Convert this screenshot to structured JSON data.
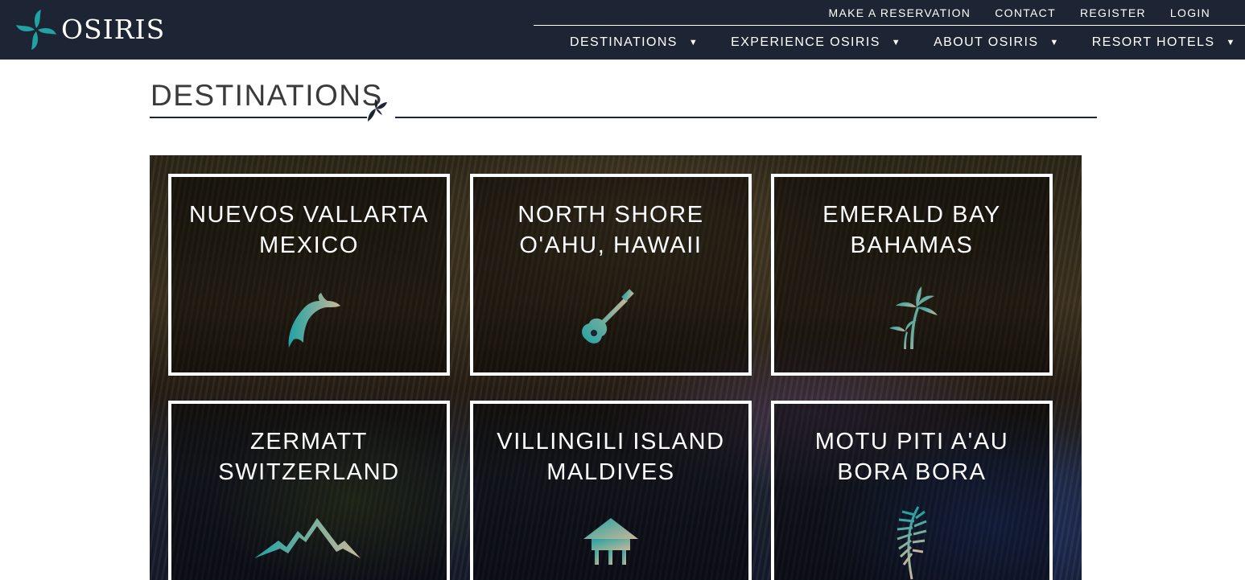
{
  "brand": {
    "name": "OSIRIS"
  },
  "utility_nav": [
    "MAKE A RESERVATION",
    "CONTACT",
    "REGISTER",
    "LOGIN"
  ],
  "main_nav": [
    {
      "label": "DESTINATIONS",
      "caret": "▼"
    },
    {
      "label": "EXPERIENCE OSIRIS",
      "caret": "▼"
    },
    {
      "label": "ABOUT OSIRIS",
      "caret": "▼"
    },
    {
      "label": "RESORT HOTELS",
      "caret": "▼"
    }
  ],
  "section": {
    "title": "DESTINATIONS",
    "icon": "leaf-icon"
  },
  "destinations": [
    {
      "line1": "NUEVOS VALLARTA",
      "line2": "MEXICO",
      "icon": "dolphin-icon"
    },
    {
      "line1": "NORTH SHORE",
      "line2": "O'AHU, HAWAII",
      "icon": "ukulele-icon"
    },
    {
      "line1": "EMERALD BAY",
      "line2": "BAHAMAS",
      "icon": "palm-tree-icon"
    },
    {
      "line1": "ZERMATT",
      "line2": "SWITZERLAND",
      "icon": "mountain-icon"
    },
    {
      "line1": "VILLINGILI ISLAND",
      "line2": "MALDIVES",
      "icon": "hut-icon"
    },
    {
      "line1": "MOTU PITI A'AU",
      "line2": "BORA BORA",
      "icon": "palm-frond-icon"
    }
  ],
  "colors": {
    "header_bg": "#1d2433",
    "icon_teal": "#1fa3a3",
    "icon_sand": "#c9b79a"
  }
}
